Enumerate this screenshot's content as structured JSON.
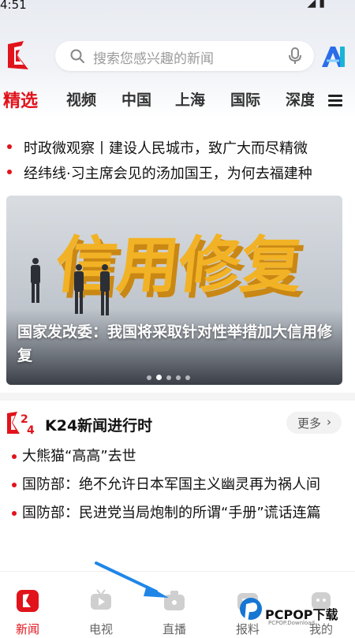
{
  "status_bar": {
    "time": "4:51"
  },
  "search": {
    "placeholder": "搜索您感兴趣的新闻"
  },
  "tabs": [
    "精选",
    "视频",
    "中国",
    "上海",
    "国际",
    "深度"
  ],
  "headlines": [
    "时政微观察丨建设人民城市，致广大而尽精微",
    "经纬线·习主席会见的汤加国王，为何去福建种"
  ],
  "banner": {
    "image_text": "信用修复",
    "caption": "国家发改委：我国将采取针对性举措加大信用修复",
    "carousel_total": 5,
    "carousel_active": 2
  },
  "k24": {
    "logo_text": "K24",
    "title": "K24新闻进行时",
    "more_label": "更多",
    "news": [
      "大熊猫“高高”去世",
      "国防部：绝不允许日本军国主义幽灵再为祸人间",
      "国防部：民进党当局炮制的所谓“手册”谎话连篇"
    ]
  },
  "bottom_nav": [
    {
      "label": "新闻",
      "icon": "news-logo-icon"
    },
    {
      "label": "电视",
      "icon": "tv-icon"
    },
    {
      "label": "直播",
      "icon": "live-camera-icon"
    },
    {
      "label": "报料",
      "icon": "report-icon"
    },
    {
      "label": "我的",
      "icon": "profile-icon"
    }
  ],
  "watermark": {
    "text": "PCPOP下载",
    "sub": "PCPOP.Download"
  },
  "colors": {
    "accent": "#e1131b",
    "banner_text": "#f2b225"
  }
}
